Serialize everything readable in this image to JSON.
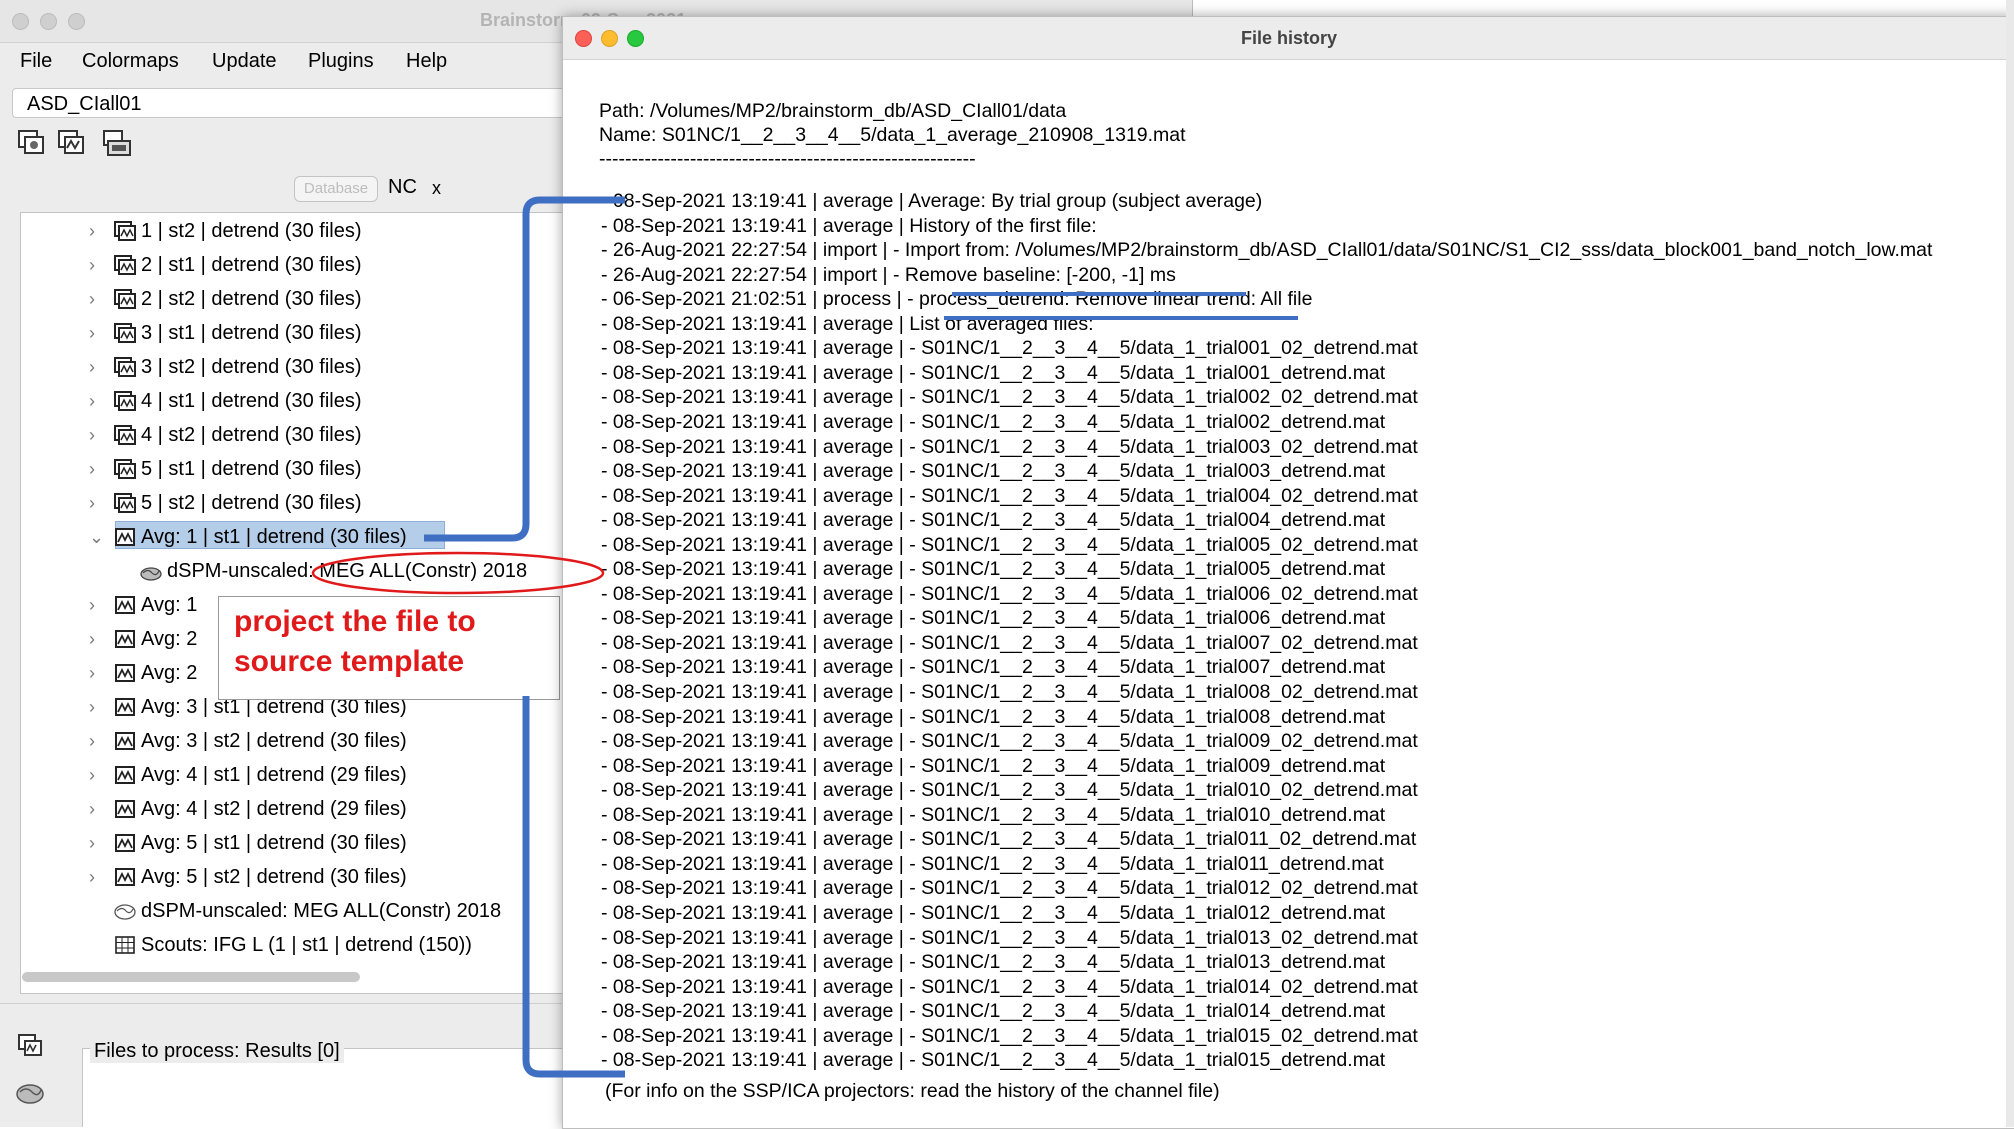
{
  "main_window": {
    "title": "Brainstorm 09-Sep-2021",
    "menu": [
      "File",
      "Colormaps",
      "Update",
      "Plugins",
      "Help"
    ],
    "protocol": "ASD_CIall01",
    "database_button": "Database",
    "tab_label": "NC",
    "tab_close": "x",
    "tree_rows": [
      {
        "text": "1  | st2 | detrend (30 files)",
        "icon": "epoch-stack-icon",
        "chevron": "›"
      },
      {
        "text": "2  | st1 | detrend (30 files)",
        "icon": "epoch-stack-icon",
        "chevron": "›"
      },
      {
        "text": "2  | st2 | detrend (30 files)",
        "icon": "epoch-stack-icon",
        "chevron": "›"
      },
      {
        "text": "3  | st1 | detrend (30 files)",
        "icon": "epoch-stack-icon",
        "chevron": "›"
      },
      {
        "text": "3  | st2 | detrend (30 files)",
        "icon": "epoch-stack-icon",
        "chevron": "›"
      },
      {
        "text": "4  | st1 | detrend (30 files)",
        "icon": "epoch-stack-icon",
        "chevron": "›"
      },
      {
        "text": "4  | st2 | detrend (30 files)",
        "icon": "epoch-stack-icon",
        "chevron": "›"
      },
      {
        "text": "5  | st1 | detrend (30 files)",
        "icon": "epoch-stack-icon",
        "chevron": "›"
      },
      {
        "text": "5  | st2 | detrend (30 files)",
        "icon": "epoch-stack-icon",
        "chevron": "›"
      },
      {
        "text": "Avg: 1  | st1 | detrend (30 files)",
        "icon": "average-icon",
        "chevron": "⌄",
        "selected": true
      },
      {
        "text": "dSPM-unscaled: MEG ALL(Constr) 2018",
        "icon": "link-brain-icon",
        "chevron": "",
        "child": true
      },
      {
        "text": "Avg: 1",
        "icon": "average-icon",
        "chevron": "›"
      },
      {
        "text": "Avg: 2",
        "icon": "average-icon",
        "chevron": "›"
      },
      {
        "text": "Avg: 2",
        "icon": "average-icon",
        "chevron": "›"
      },
      {
        "text": "Avg: 3  | st1 | detrend (30 files)",
        "icon": "average-icon",
        "chevron": "›"
      },
      {
        "text": "Avg: 3  | st2 | detrend (30 files)",
        "icon": "average-icon",
        "chevron": "›"
      },
      {
        "text": "Avg: 4  | st1 | detrend (29 files)",
        "icon": "average-icon",
        "chevron": "›"
      },
      {
        "text": "Avg: 4  | st2 | detrend (29 files)",
        "icon": "average-icon",
        "chevron": "›"
      },
      {
        "text": "Avg: 5  | st1 | detrend (30 files)",
        "icon": "average-icon",
        "chevron": "›"
      },
      {
        "text": "Avg: 5  | st2 | detrend (30 files)",
        "icon": "average-icon",
        "chevron": "›"
      },
      {
        "text": "dSPM-unscaled: MEG ALL(Constr) 2018",
        "icon": "brain-icon",
        "chevron": ""
      },
      {
        "text": "Scouts: IFG L (1  | st1 | detrend (150))",
        "icon": "matrix-icon",
        "chevron": ""
      }
    ],
    "files_to_process": "Files to process: Results [0]"
  },
  "annotation": {
    "text": "project the file to\nsource template",
    "colors": {
      "red": "#e01a1a",
      "blue": "#3f6fc2"
    }
  },
  "history_window": {
    "title": "File history",
    "path": "Path: /Volumes/MP2/brainstorm_db/ASD_CIall01/data",
    "name": "Name: S01NC/1__2__3__4__5/data_1_average_210908_1319.mat",
    "separator": "----------------------------------------------------------",
    "entries": [
      "- 08-Sep-2021 13:19:41 | average | Average: By trial group (subject average)",
      "- 08-Sep-2021 13:19:41 | average | History of the first file:",
      "- 26-Aug-2021 22:27:54 | import  |  - Import from: /Volumes/MP2/brainstorm_db/ASD_CIall01/data/S01NC/S1_CI2_sss/data_block001_band_notch_low.mat",
      "- 26-Aug-2021 22:27:54 | import  |  -    Remove baseline: [-200, -1] ms",
      "- 06-Sep-2021 21:02:51 | process |  - process_detrend: Remove linear trend: All file",
      "- 08-Sep-2021 13:19:41 | average | List of averaged files:",
      "- 08-Sep-2021 13:19:41 | average |  - S01NC/1__2__3__4__5/data_1_trial001_02_detrend.mat",
      "- 08-Sep-2021 13:19:41 | average |  - S01NC/1__2__3__4__5/data_1_trial001_detrend.mat",
      "- 08-Sep-2021 13:19:41 | average |  - S01NC/1__2__3__4__5/data_1_trial002_02_detrend.mat",
      "- 08-Sep-2021 13:19:41 | average |  - S01NC/1__2__3__4__5/data_1_trial002_detrend.mat",
      "- 08-Sep-2021 13:19:41 | average |  - S01NC/1__2__3__4__5/data_1_trial003_02_detrend.mat",
      "- 08-Sep-2021 13:19:41 | average |  - S01NC/1__2__3__4__5/data_1_trial003_detrend.mat",
      "- 08-Sep-2021 13:19:41 | average |  - S01NC/1__2__3__4__5/data_1_trial004_02_detrend.mat",
      "- 08-Sep-2021 13:19:41 | average |  - S01NC/1__2__3__4__5/data_1_trial004_detrend.mat",
      "- 08-Sep-2021 13:19:41 | average |  - S01NC/1__2__3__4__5/data_1_trial005_02_detrend.mat",
      "- 08-Sep-2021 13:19:41 | average |  - S01NC/1__2__3__4__5/data_1_trial005_detrend.mat",
      "- 08-Sep-2021 13:19:41 | average |  - S01NC/1__2__3__4__5/data_1_trial006_02_detrend.mat",
      "- 08-Sep-2021 13:19:41 | average |  - S01NC/1__2__3__4__5/data_1_trial006_detrend.mat",
      "- 08-Sep-2021 13:19:41 | average |  - S01NC/1__2__3__4__5/data_1_trial007_02_detrend.mat",
      "- 08-Sep-2021 13:19:41 | average |  - S01NC/1__2__3__4__5/data_1_trial007_detrend.mat",
      "- 08-Sep-2021 13:19:41 | average |  - S01NC/1__2__3__4__5/data_1_trial008_02_detrend.mat",
      "- 08-Sep-2021 13:19:41 | average |  - S01NC/1__2__3__4__5/data_1_trial008_detrend.mat",
      "- 08-Sep-2021 13:19:41 | average |  - S01NC/1__2__3__4__5/data_1_trial009_02_detrend.mat",
      "- 08-Sep-2021 13:19:41 | average |  - S01NC/1__2__3__4__5/data_1_trial009_detrend.mat",
      "- 08-Sep-2021 13:19:41 | average |  - S01NC/1__2__3__4__5/data_1_trial010_02_detrend.mat",
      "- 08-Sep-2021 13:19:41 | average |  - S01NC/1__2__3__4__5/data_1_trial010_detrend.mat",
      "- 08-Sep-2021 13:19:41 | average |  - S01NC/1__2__3__4__5/data_1_trial011_02_detrend.mat",
      "- 08-Sep-2021 13:19:41 | average |  - S01NC/1__2__3__4__5/data_1_trial011_detrend.mat",
      "- 08-Sep-2021 13:19:41 | average |  - S01NC/1__2__3__4__5/data_1_trial012_02_detrend.mat",
      "- 08-Sep-2021 13:19:41 | average |  - S01NC/1__2__3__4__5/data_1_trial012_detrend.mat",
      "- 08-Sep-2021 13:19:41 | average |  - S01NC/1__2__3__4__5/data_1_trial013_02_detrend.mat",
      "- 08-Sep-2021 13:19:41 | average |  - S01NC/1__2__3__4__5/data_1_trial013_detrend.mat",
      "- 08-Sep-2021 13:19:41 | average |  - S01NC/1__2__3__4__5/data_1_trial014_02_detrend.mat",
      "- 08-Sep-2021 13:19:41 | average |  - S01NC/1__2__3__4__5/data_1_trial014_detrend.mat",
      "- 08-Sep-2021 13:19:41 | average |  - S01NC/1__2__3__4__5/data_1_trial015_02_detrend.mat",
      "- 08-Sep-2021 13:19:41 | average |  - S01NC/1__2__3__4__5/data_1_trial015_detrend.mat"
    ],
    "footer": " (For info on the SSP/ICA projectors: read the history of the channel file)"
  }
}
